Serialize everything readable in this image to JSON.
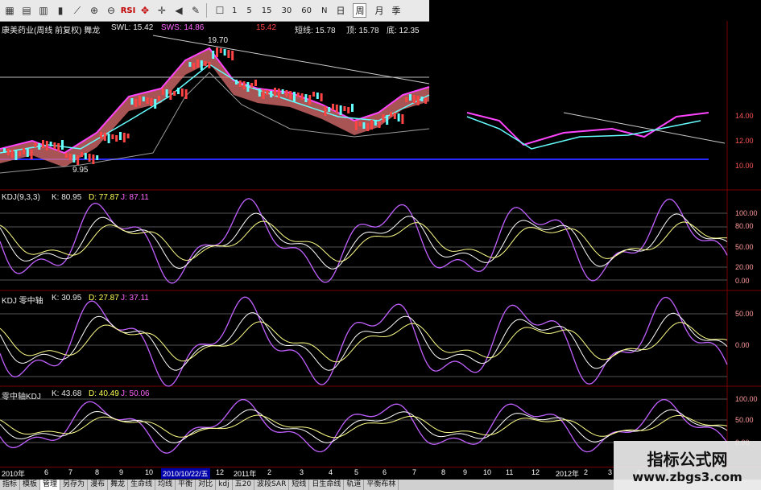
{
  "toolbar": {
    "icons": [
      "grid-icon",
      "chart-icon",
      "candle-icon",
      "bar-icon",
      "line-icon",
      "zoomin-icon",
      "zoomout-icon"
    ],
    "rsi": "RSI",
    "periods": [
      "1",
      "5",
      "15",
      "30",
      "60",
      "N",
      "日",
      "周",
      "月",
      "季"
    ],
    "active_period": "周"
  },
  "main_panel": {
    "title": "康美药业(周线 前复权) 舞龙",
    "swl": "SWL: 15.42",
    "sws": "SWS: 14.86",
    "val3": "15.42",
    "duanxian": "短线: 15.78",
    "ding": "顶: 15.78",
    "di": "底: 12.35",
    "high_mark": "19.70",
    "low_mark": "9.95",
    "yticks": [
      "14.00",
      "12.00",
      "10.00"
    ]
  },
  "kdj1": {
    "name": "KDJ(9,3,3)",
    "k": "K: 80.95",
    "d": "D: 77.87",
    "j": "J: 87.11",
    "yticks": [
      "100.00",
      "80.00",
      "50.00",
      "20.00",
      "0.00"
    ]
  },
  "kdj2": {
    "name": "KDJ 零中轴",
    "k": "K: 30.95",
    "d": "D: 27.87",
    "j": "J: 37.11",
    "yticks": [
      "50.00",
      "0.00"
    ]
  },
  "kdj3": {
    "name": "零中轴KDJ",
    "k": "K: 43.68",
    "d": "D: 40.49",
    "j": "J: 50.06",
    "yticks": [
      "100.00",
      "50.00",
      "0.00"
    ]
  },
  "dates": [
    "2010年",
    "6",
    "7",
    "8",
    "9",
    "10",
    "11",
    "12",
    "2011年",
    "2",
    "3",
    "4",
    "5",
    "6",
    "7",
    "8",
    "9",
    "10",
    "11",
    "12",
    "2012年",
    "2",
    "3",
    "4",
    "5"
  ],
  "date_highlight": "2010/10/22/五",
  "tabs": [
    "指标",
    "模板",
    "管理",
    "另存为",
    "漫布",
    "舞龙",
    "生命线",
    "均线",
    "平衡",
    "对比",
    "kdj",
    "五20",
    "波段SAR",
    "短线",
    "日生命线",
    "轨道",
    "平衡布林"
  ],
  "active_tab": "管理",
  "watermark": {
    "line1": "指标公式网",
    "line2": "www.zbgs3.com"
  }
}
